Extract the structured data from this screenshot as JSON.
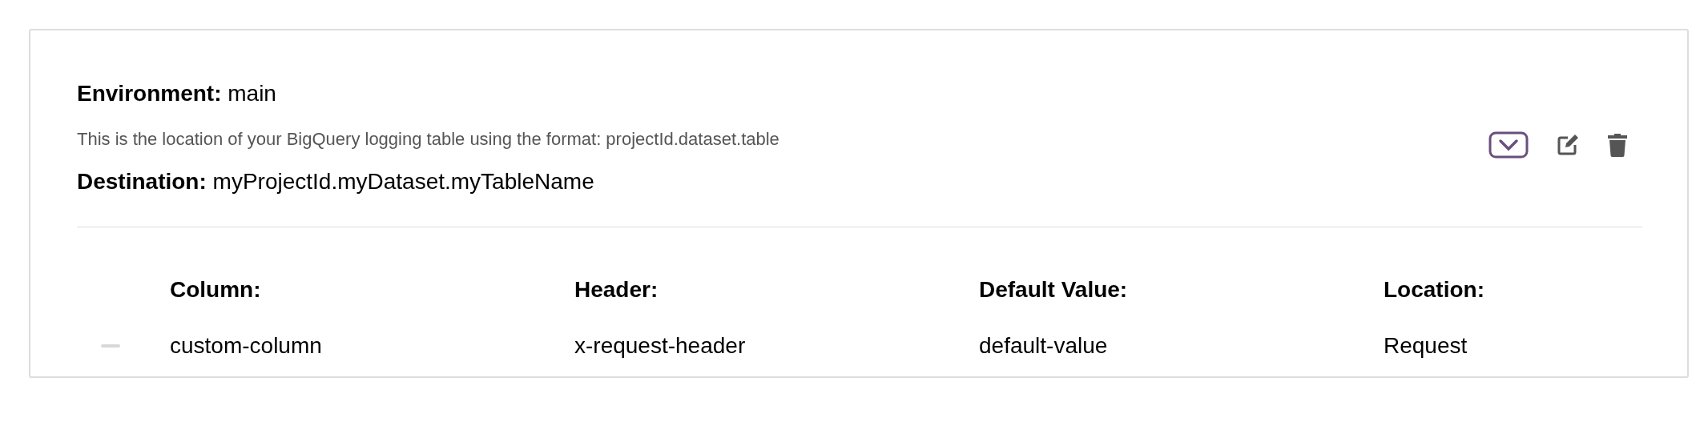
{
  "environment": "**Environment:** main",
  "description": "This is the location of your BigQuery logging table using the format: projectId.dataset.table",
  "destination": "**Destination:** myProjectId.myDataset.myTableName",
  "table": {
    "columns": [
      "Column:",
      "Header:",
      "Default Value:",
      "Location:"
    ],
    "rows": [
      [
        "custom-column",
        "x-request-header",
        "default-value",
        "Request"
      ]
    ]
  }
}
